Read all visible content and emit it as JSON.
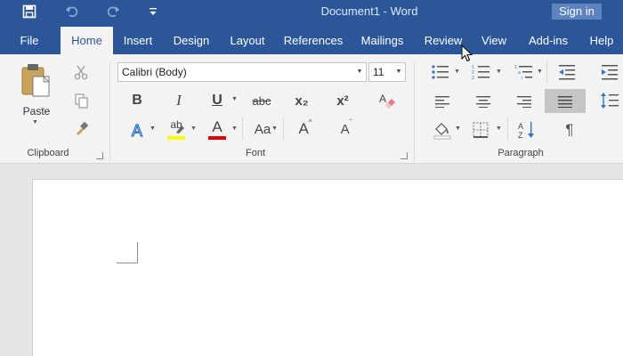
{
  "window": {
    "title": "Document1  -  Word",
    "signin_label": "Sign in"
  },
  "qat": {
    "save_icon": "save-icon",
    "undo_icon": "undo-icon",
    "redo_icon": "redo-icon",
    "customize_icon": "customize-qat-icon"
  },
  "tabs": [
    "File",
    "Home",
    "Insert",
    "Design",
    "Layout",
    "References",
    "Mailings",
    "Review",
    "View",
    "Add-ins",
    "Help"
  ],
  "active_tab": "Home",
  "ribbon": {
    "clipboard": {
      "label": "Clipboard",
      "paste_label": "Paste"
    },
    "font": {
      "label": "Font",
      "font_name": "Calibri (Body)",
      "font_size": "11",
      "bold": "B",
      "italic": "I",
      "underline": "U",
      "strikethrough": "abc",
      "subscript": "x₂",
      "superscript": "x²",
      "highlight": "ab",
      "font_color": "A",
      "change_case": "Aa",
      "grow_font": "A",
      "shrink_font": "A",
      "highlight_color": "#ffff00",
      "font_color_value": "#e00000"
    },
    "paragraph": {
      "label": "Paragraph",
      "show_marks": "¶"
    }
  },
  "colors": {
    "brand": "#2b579a",
    "ribbon_bg": "#f3f3f3",
    "doc_bg": "#e6e6e6"
  }
}
